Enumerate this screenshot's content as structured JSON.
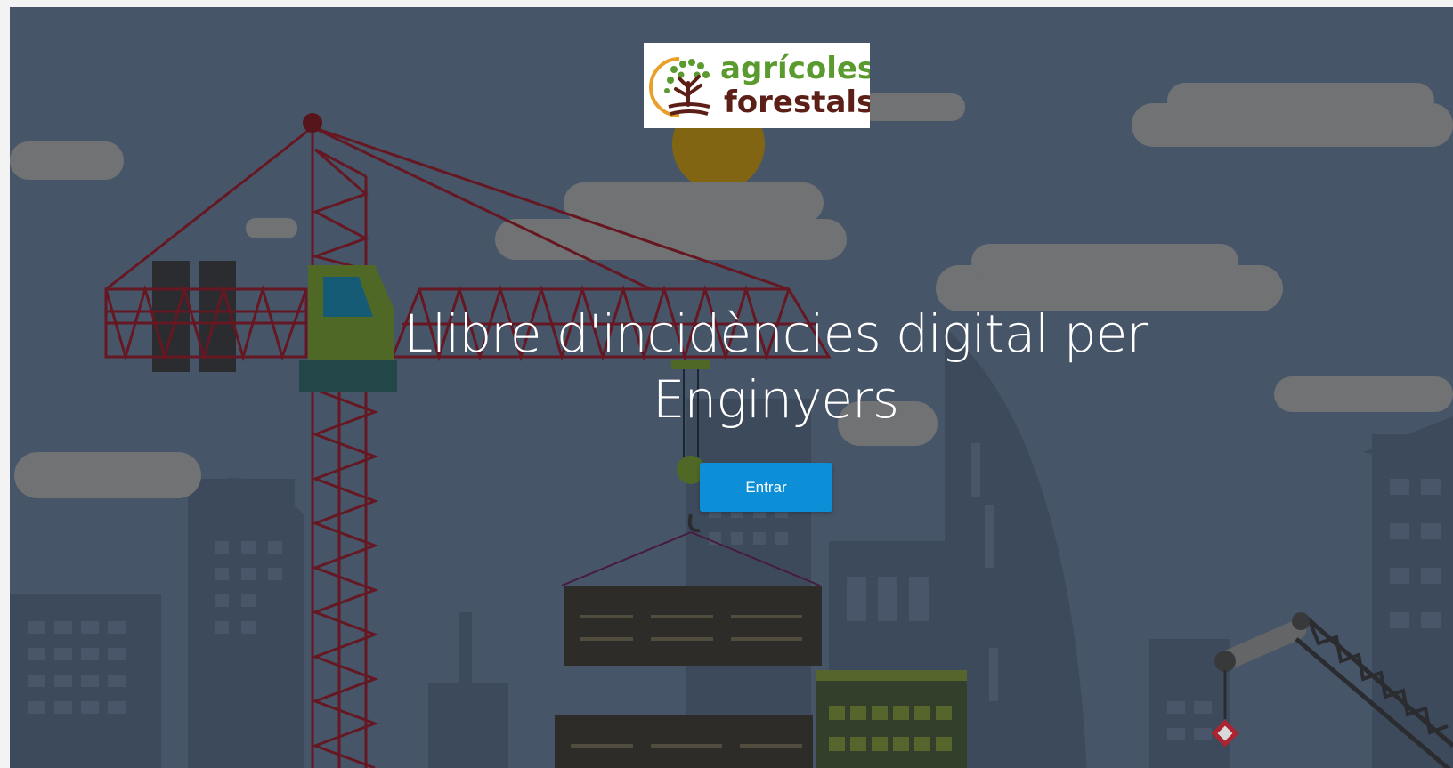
{
  "logo": {
    "line1": "agrícoles",
    "line2": "forestals",
    "colors": {
      "green": "#5a9a2e",
      "brown": "#5b1f17",
      "orange": "#e8a02a"
    }
  },
  "hero": {
    "title_line1": "Llibre d'incidències digital per",
    "title_line2": "Enginyers",
    "button_label": "Entrar"
  },
  "colors": {
    "background": "#4a586d",
    "button": "#0d8fd8",
    "crane": "#6b1520",
    "cloud": "#787878",
    "sun": "#8a6a10"
  }
}
